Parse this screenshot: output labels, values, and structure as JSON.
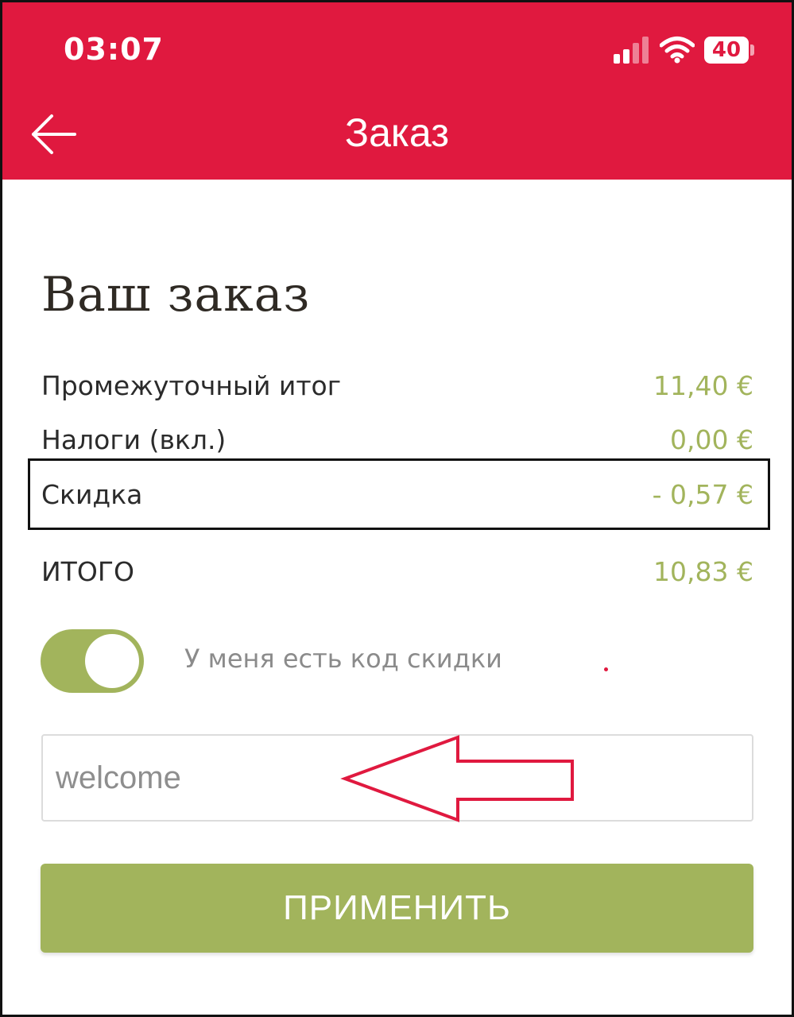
{
  "status_bar": {
    "time": "03:07",
    "battery": "40",
    "signal_icon": "cellular-signal-icon",
    "wifi_icon": "wifi-icon"
  },
  "header": {
    "title": "Заказ",
    "back_icon": "arrow-left-icon",
    "color": "#e0193f"
  },
  "order": {
    "section_title": "Ваш заказ",
    "rows": [
      {
        "label": "Промежуточный итог",
        "value": "11,40 €"
      },
      {
        "label": "Налоги (вкл.)",
        "value": "0,00 €"
      },
      {
        "label": "Скидка",
        "value": "- 0,57 €"
      }
    ],
    "total_label": "ИТОГО",
    "total_value": "10,83 €"
  },
  "discount": {
    "toggle_label": "У меня есть код скидки",
    "toggle_on": true,
    "code_value": "welcome",
    "apply_label": "ПРИМЕНИТЬ"
  },
  "colors": {
    "accent_green": "#a2b45c",
    "brand_red": "#e0193f"
  }
}
